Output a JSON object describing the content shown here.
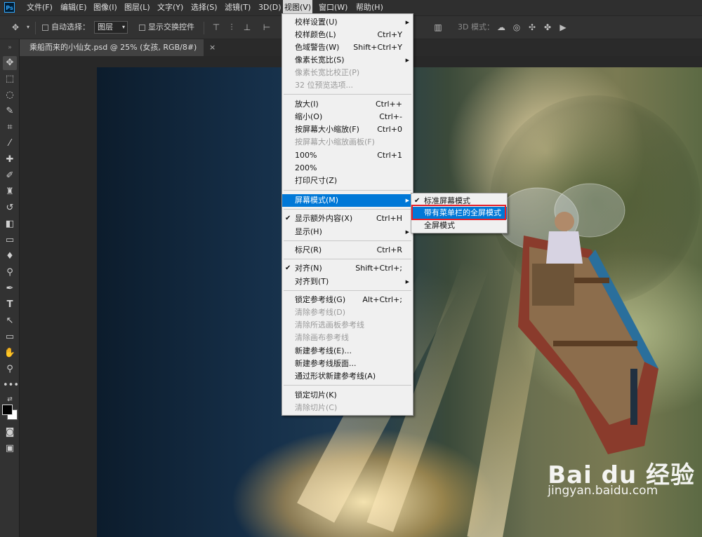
{
  "app": {
    "logo": "Ps"
  },
  "menubar": {
    "items": [
      "文件(F)",
      "编辑(E)",
      "图像(I)",
      "图层(L)",
      "文字(Y)",
      "选择(S)",
      "滤镜(T)",
      "3D(D)",
      "视图(V)",
      "窗口(W)",
      "帮助(H)"
    ],
    "active_index": 8
  },
  "options_bar": {
    "auto_select_label": "自动选择：",
    "auto_select_value": "图层",
    "show_transform_label": "显示交换控件",
    "mode_3d_label": "3D 模式："
  },
  "document_tab": {
    "title": "乘船而来的小仙女.psd @ 25% (女孩, RGB/8#)",
    "close": "×"
  },
  "view_menu": {
    "items": [
      {
        "label": "校样设置(U)",
        "shortcut": "",
        "submenu": true,
        "disabled": false,
        "checked": false
      },
      {
        "label": "校样颜色(L)",
        "shortcut": "Ctrl+Y",
        "submenu": false,
        "disabled": false,
        "checked": false
      },
      {
        "label": "色域警告(W)",
        "shortcut": "Shift+Ctrl+Y",
        "submenu": false,
        "disabled": false,
        "checked": false
      },
      {
        "label": "像素长宽比(S)",
        "shortcut": "",
        "submenu": true,
        "disabled": false,
        "checked": false
      },
      {
        "label": "像素长宽比校正(P)",
        "shortcut": "",
        "submenu": false,
        "disabled": true,
        "checked": false
      },
      {
        "label": "32 位预览选项...",
        "shortcut": "",
        "submenu": false,
        "disabled": true,
        "checked": false
      },
      {
        "label": "放大(I)",
        "shortcut": "Ctrl++",
        "submenu": false,
        "disabled": false,
        "checked": false
      },
      {
        "label": "缩小(O)",
        "shortcut": "Ctrl+-",
        "submenu": false,
        "disabled": false,
        "checked": false
      },
      {
        "label": "按屏幕大小缩放(F)",
        "shortcut": "Ctrl+0",
        "submenu": false,
        "disabled": false,
        "checked": false
      },
      {
        "label": "按屏幕大小缩放画板(F)",
        "shortcut": "",
        "submenu": false,
        "disabled": true,
        "checked": false
      },
      {
        "label": "100%",
        "shortcut": "Ctrl+1",
        "submenu": false,
        "disabled": false,
        "checked": false
      },
      {
        "label": "200%",
        "shortcut": "",
        "submenu": false,
        "disabled": false,
        "checked": false
      },
      {
        "label": "打印尺寸(Z)",
        "shortcut": "",
        "submenu": false,
        "disabled": false,
        "checked": false
      },
      {
        "label": "屏幕模式(M)",
        "shortcut": "",
        "submenu": true,
        "disabled": false,
        "checked": false,
        "highlighted": true
      },
      {
        "label": "显示额外内容(X)",
        "shortcut": "Ctrl+H",
        "submenu": false,
        "disabled": false,
        "checked": true
      },
      {
        "label": "显示(H)",
        "shortcut": "",
        "submenu": true,
        "disabled": false,
        "checked": false
      },
      {
        "label": "标尺(R)",
        "shortcut": "Ctrl+R",
        "submenu": false,
        "disabled": false,
        "checked": false
      },
      {
        "label": "对齐(N)",
        "shortcut": "Shift+Ctrl+;",
        "submenu": false,
        "disabled": false,
        "checked": true
      },
      {
        "label": "对齐到(T)",
        "shortcut": "",
        "submenu": true,
        "disabled": false,
        "checked": false
      },
      {
        "label": "锁定参考线(G)",
        "shortcut": "Alt+Ctrl+;",
        "submenu": false,
        "disabled": false,
        "checked": false
      },
      {
        "label": "清除参考线(D)",
        "shortcut": "",
        "submenu": false,
        "disabled": true,
        "checked": false
      },
      {
        "label": "清除所选画板参考线",
        "shortcut": "",
        "submenu": false,
        "disabled": true,
        "checked": false
      },
      {
        "label": "清除画布参考线",
        "shortcut": "",
        "submenu": false,
        "disabled": true,
        "checked": false
      },
      {
        "label": "新建参考线(E)...",
        "shortcut": "",
        "submenu": false,
        "disabled": false,
        "checked": false
      },
      {
        "label": "新建参考线版面...",
        "shortcut": "",
        "submenu": false,
        "disabled": false,
        "checked": false
      },
      {
        "label": "通过形状新建参考线(A)",
        "shortcut": "",
        "submenu": false,
        "disabled": false,
        "checked": false
      },
      {
        "label": "锁定切片(K)",
        "shortcut": "",
        "submenu": false,
        "disabled": false,
        "checked": false
      },
      {
        "label": "清除切片(C)",
        "shortcut": "",
        "submenu": false,
        "disabled": true,
        "checked": false
      }
    ]
  },
  "screen_mode_submenu": {
    "items": [
      {
        "label": "标准屏幕模式",
        "checked": true,
        "highlighted": false
      },
      {
        "label": "带有菜单栏的全屏模式",
        "checked": false,
        "highlighted": true
      },
      {
        "label": "全屏模式",
        "checked": false,
        "highlighted": false
      }
    ]
  },
  "watermark": {
    "main": "Bai du 经验",
    "sub": "jingyan.baidu.com"
  },
  "colors": {
    "menu_highlight": "#0078d7",
    "annotation_box": "#e5202a",
    "ps_blue": "#31a8ff"
  }
}
